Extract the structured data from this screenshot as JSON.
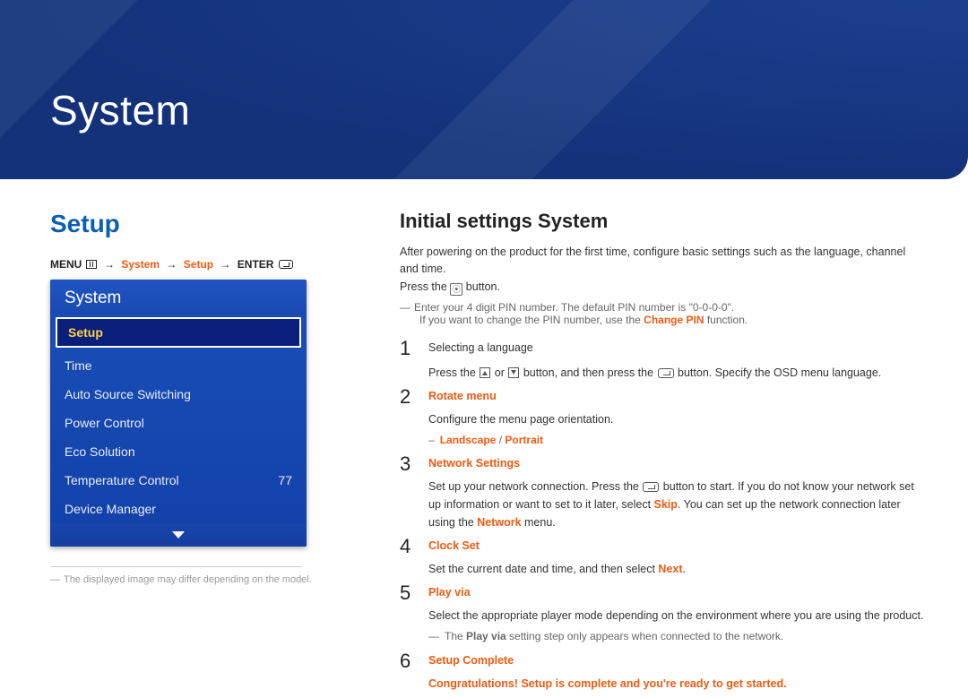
{
  "banner": {
    "title": "System"
  },
  "left": {
    "heading": "Setup",
    "breadcrumb": {
      "menu": "MENU",
      "system": "System",
      "setup": "Setup",
      "enter": "ENTER"
    },
    "menu": {
      "title": "System",
      "items": [
        {
          "label": "Setup",
          "selected": true
        },
        {
          "label": "Time"
        },
        {
          "label": "Auto Source Switching"
        },
        {
          "label": "Power Control"
        },
        {
          "label": "Eco Solution"
        },
        {
          "label": "Temperature Control",
          "value": "77"
        },
        {
          "label": "Device Manager"
        }
      ]
    },
    "footnote": "The displayed image may differ depending on the model."
  },
  "right": {
    "title": "Initial settings System",
    "intro_line1": "After powering on the product for the first time, configure basic settings such as the language, channel and time.",
    "intro_line2_a": "Press the ",
    "intro_line2_b": " button.",
    "pin_note_a": "Enter your 4 digit PIN number. The default PIN number is \"0-0-0-0\".",
    "pin_note_b_pre": "If you want to change the PIN number, use the ",
    "pin_note_b_hl": "Change PIN",
    "pin_note_b_post": " function.",
    "steps": [
      {
        "n": "1",
        "lead": "Selecting a language",
        "lead_style": "black",
        "desc_a": "Press the ",
        "desc_b": " or ",
        "desc_c": " button, and then press the ",
        "desc_d": " button. Specify the OSD menu language."
      },
      {
        "n": "2",
        "lead": "Rotate menu",
        "lead_style": "orange",
        "desc": "Configure the menu page orientation.",
        "sub_pre": "",
        "sub_a": "Landscape",
        "sub_mid": " / ",
        "sub_b": "Portrait"
      },
      {
        "n": "3",
        "lead": "Network Settings",
        "lead_style": "orange",
        "desc_pre": "Set up your network connection. Press the ",
        "desc_mid": " button to start. If you do not know your network set up information or want to set to it later, select ",
        "desc_skip": "Skip",
        "desc_post_a": ". You can set up the network connection later using the ",
        "desc_net": "Network",
        "desc_post_b": " menu."
      },
      {
        "n": "4",
        "lead": "Clock Set",
        "lead_style": "orange",
        "desc_a": "Set the current date and time, and then select ",
        "desc_next": "Next",
        "desc_b": "."
      },
      {
        "n": "5",
        "lead": "Play via",
        "lead_style": "orange",
        "desc": "Select the appropriate player mode depending on the environment where you are using the product.",
        "sub_pre": "The ",
        "sub_hl": "Play via",
        "sub_post": " setting step only appears when connected to the network."
      },
      {
        "n": "6",
        "lead": "Setup Complete",
        "lead_style": "orange",
        "desc_hl": "Congratulations! Setup is complete and you're ready to get started."
      }
    ]
  }
}
